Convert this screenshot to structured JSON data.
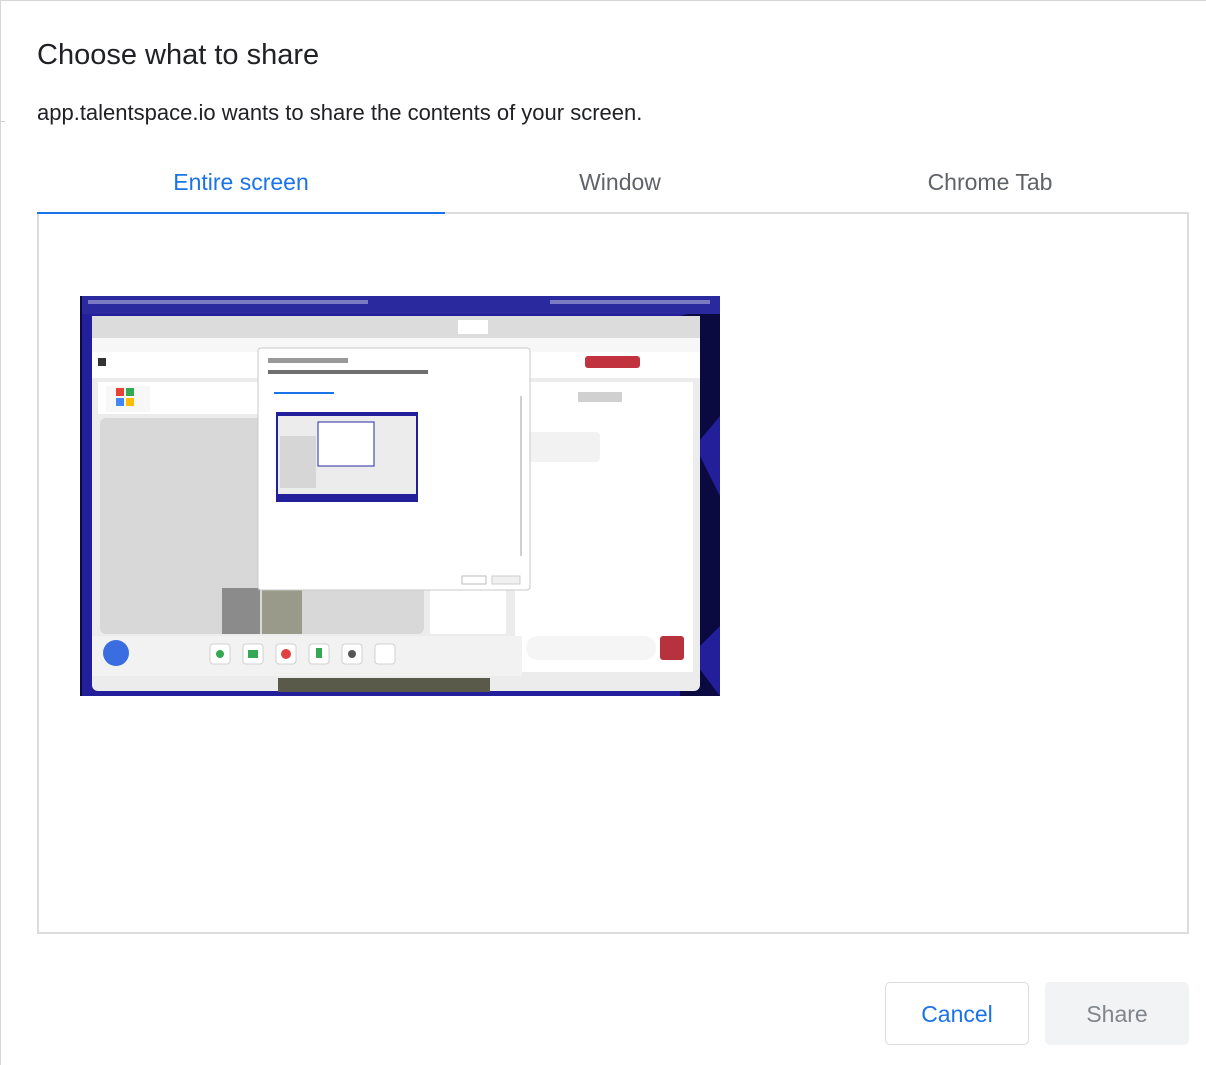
{
  "dialog": {
    "title": "Choose what to share",
    "subtitle": "app.talentspace.io wants to share the contents of your screen."
  },
  "tabs": [
    {
      "label": "Entire screen",
      "selected": true
    },
    {
      "label": "Window",
      "selected": false
    },
    {
      "label": "Chrome Tab",
      "selected": false
    }
  ],
  "preview": {
    "icon": "screen-preview-thumbnail"
  },
  "buttons": {
    "cancel_label": "Cancel",
    "share_label": "Share"
  },
  "colors": {
    "accent": "#1a73e8",
    "desktop_bg": "#1e1a8c",
    "disabled_text": "#80868b"
  }
}
